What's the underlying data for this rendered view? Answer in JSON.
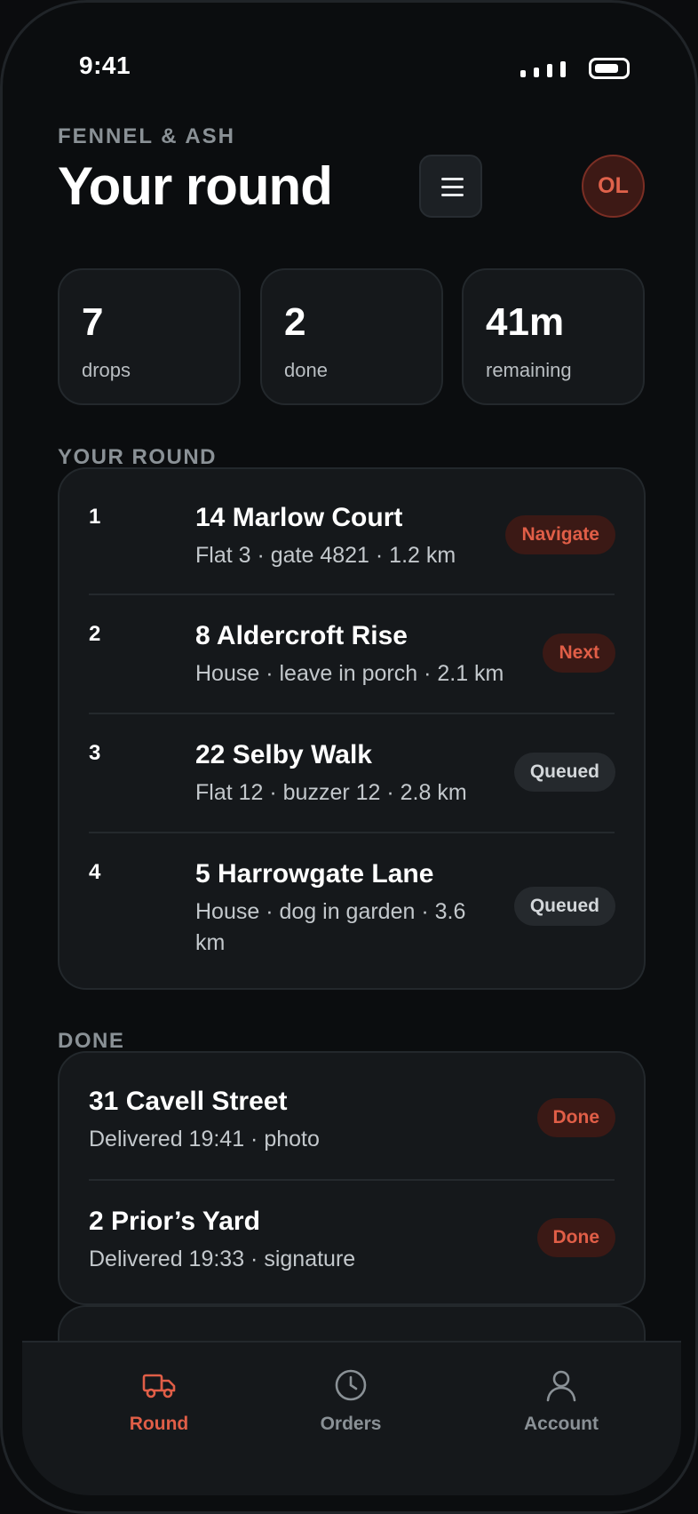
{
  "status_bar": {
    "time": "9:41"
  },
  "header": {
    "brand": "FENNEL & ASH",
    "title": "Your round",
    "avatar_initials": "OL"
  },
  "stats": [
    {
      "value": "7",
      "label": "drops"
    },
    {
      "value": "2",
      "label": "done"
    },
    {
      "value": "41m",
      "label": "remaining"
    }
  ],
  "round": {
    "heading": "YOUR ROUND",
    "items": [
      {
        "num": "1",
        "address": "14 Marlow Court",
        "detail": "Flat 3 · gate 4821 · 1.2 km",
        "action": "Navigate"
      },
      {
        "num": "2",
        "address": "8 Aldercroft Rise",
        "detail": "House · leave in porch · 2.1 km",
        "action": "Next"
      },
      {
        "num": "3",
        "address": "22 Selby Walk",
        "detail": "Flat 12 · buzzer 12 · 2.8 km",
        "action": "Queued"
      },
      {
        "num": "4",
        "address": "5 Harrowgate Lane",
        "detail_line1": "House · dog in garden · 3.6",
        "detail_line2": "km",
        "action": "Queued"
      }
    ]
  },
  "done": {
    "heading": "DONE",
    "items": [
      {
        "address": "31 Cavell Street",
        "detail": "Delivered 19:41 · photo",
        "status": "Done"
      },
      {
        "address": "2 Prior’s Yard",
        "detail": "Delivered 19:33 · signature",
        "status": "Done"
      }
    ]
  },
  "tabs": [
    {
      "label": "Round",
      "icon": "truck-icon",
      "active": true
    },
    {
      "label": "Orders",
      "icon": "clock-icon",
      "active": false
    },
    {
      "label": "Account",
      "icon": "person-icon",
      "active": false
    }
  ],
  "colors": {
    "accent": "#e05e47",
    "background": "#0b0d0f",
    "card": "#15181b",
    "muted_text": "#8a9196"
  }
}
